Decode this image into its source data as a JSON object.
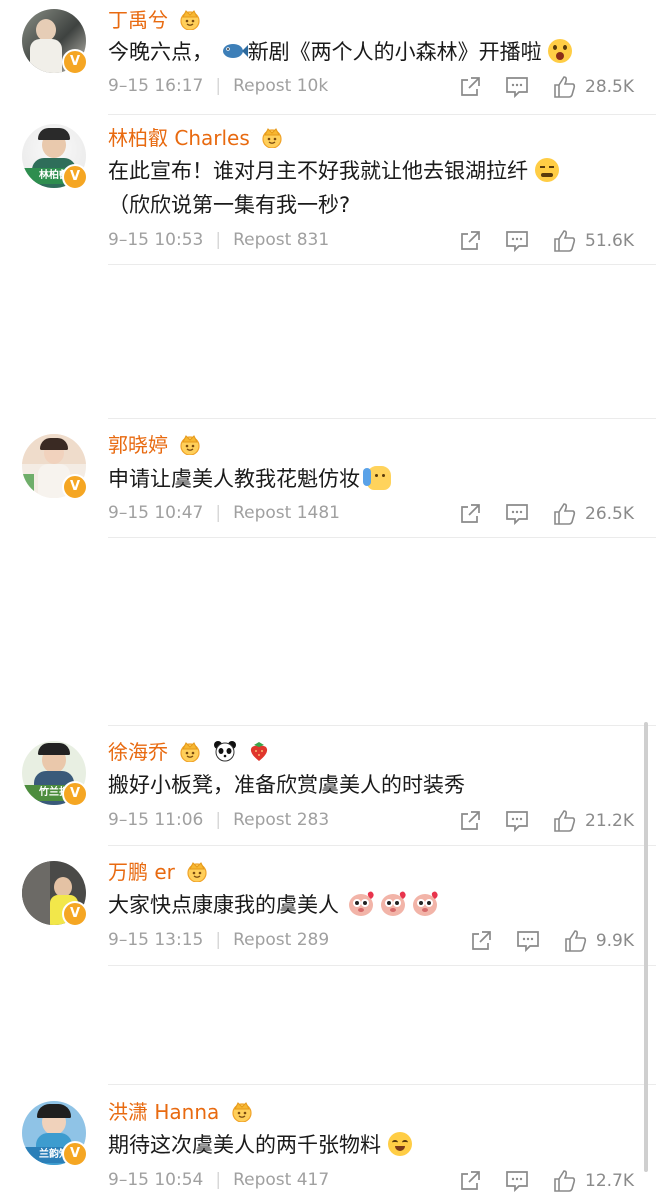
{
  "posts": [
    {
      "name": "丁禹兮",
      "content": [
        "今晚六点，",
        "新剧《两个人的小森林》开播啦"
      ],
      "date": "9–15 16:17",
      "repost": "Repost 10k",
      "likes": "28.5K"
    },
    {
      "name": "林柏叡 Charles",
      "content": [
        "在此宣布！谁对月主不好我就让他去银湖拉纤",
        "（欣欣说第一集有我一秒?"
      ],
      "date": "9–15 10:53",
      "repost": "Repost 831",
      "likes": "51.6K",
      "avatar_text": "林柏叡"
    },
    {
      "name": "郭晓婷",
      "content": [
        "申请让虞美人教我花魁仿妆"
      ],
      "date": "9–15 10:47",
      "repost": "Repost 1481",
      "likes": "26.5K"
    },
    {
      "name": "徐海乔",
      "content": [
        "搬好小板凳，准备欣赏虞美人的时装秀"
      ],
      "date": "9–15 11:06",
      "repost": "Repost 283",
      "likes": "21.2K",
      "avatar_text": "竹兰打"
    },
    {
      "name": "万鹏 er",
      "content": [
        "大家快点康康我的虞美人"
      ],
      "date": "9–15 13:15",
      "repost": "Repost 289",
      "likes": "9.9K"
    },
    {
      "name": "洪潇 Hanna",
      "content": [
        "期待这次虞美人的两千张物料"
      ],
      "date": "9–15 10:54",
      "repost": "Repost 417",
      "likes": "12.7K",
      "avatar_text": "兰韵知"
    }
  ],
  "verified_mark": "V",
  "colors": {
    "name": "#e86a10",
    "meta": "#a0a0a0",
    "verified": "#f5a623"
  },
  "icons": [
    "crown-badge-icon",
    "share-icon",
    "comment-icon",
    "like-icon",
    "verified-icon",
    "panda-icon",
    "strawberry-icon"
  ]
}
